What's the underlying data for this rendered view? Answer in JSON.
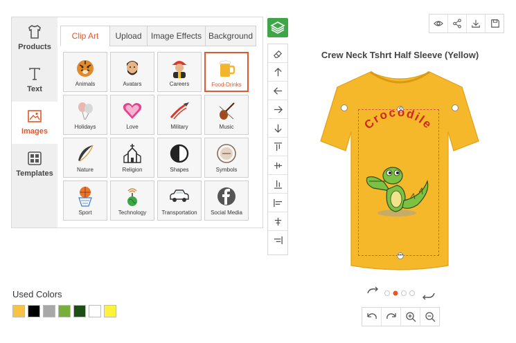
{
  "side_nav": [
    {
      "label": "Products",
      "icon": "tshirt-icon"
    },
    {
      "label": "Text",
      "icon": "text-icon"
    },
    {
      "label": "Images",
      "icon": "image-icon"
    },
    {
      "label": "Templates",
      "icon": "templates-icon"
    }
  ],
  "tabs": [
    "Clip Art",
    "Upload",
    "Image Effects",
    "Background"
  ],
  "categories": [
    {
      "label": "Animals",
      "icon": "tiger-icon"
    },
    {
      "label": "Avatars",
      "icon": "avatar-icon"
    },
    {
      "label": "Careers",
      "icon": "firefighter-icon"
    },
    {
      "label": "Food-Drinks",
      "icon": "beer-mug-icon"
    },
    {
      "label": "Holidays",
      "icon": "balloons-icon"
    },
    {
      "label": "Love",
      "icon": "heart-icon"
    },
    {
      "label": "Military",
      "icon": "fighter-jet-icon"
    },
    {
      "label": "Music",
      "icon": "violin-icon"
    },
    {
      "label": "Nature",
      "icon": "feather-icon"
    },
    {
      "label": "Religion",
      "icon": "church-icon"
    },
    {
      "label": "Shapes",
      "icon": "half-circle-icon"
    },
    {
      "label": "Symbols",
      "icon": "symbol-badge-icon"
    },
    {
      "label": "Sport",
      "icon": "basketball-icon"
    },
    {
      "label": "Technology",
      "icon": "globe-antenna-icon"
    },
    {
      "label": "Transportation",
      "icon": "car-icon"
    },
    {
      "label": "Social Media",
      "icon": "facebook-icon"
    }
  ],
  "toolbar_icons": [
    "layers-icon",
    "eraser-icon",
    "arrow-up-icon",
    "arrow-left-icon",
    "arrow-right-icon",
    "arrow-down-icon",
    "align-top-icon",
    "align-middle-icon",
    "align-bottom-icon",
    "align-left-icon",
    "align-center-icon",
    "align-right-icon"
  ],
  "actions": [
    "eye-icon",
    "share-icon",
    "download-icon",
    "save-icon"
  ],
  "product": {
    "title": "Crew Neck Tshrt Half Sleeve (Yellow)",
    "design_text": "Crocodile",
    "shirt_color": "#F5B82A"
  },
  "views": {
    "count": 4,
    "active_index": 1
  },
  "zoom_icons": [
    "undo-icon",
    "redo-icon",
    "zoom-in-icon",
    "zoom-out-icon"
  ],
  "used_colors": {
    "title": "Used Colors",
    "swatches": [
      "#F6C344",
      "#000000",
      "#A8A8A8",
      "#78AE3C",
      "#1F4D18",
      "#FFFFFF",
      "#FFF23A"
    ]
  },
  "accent": "#E2572B",
  "green": "#3FA648"
}
